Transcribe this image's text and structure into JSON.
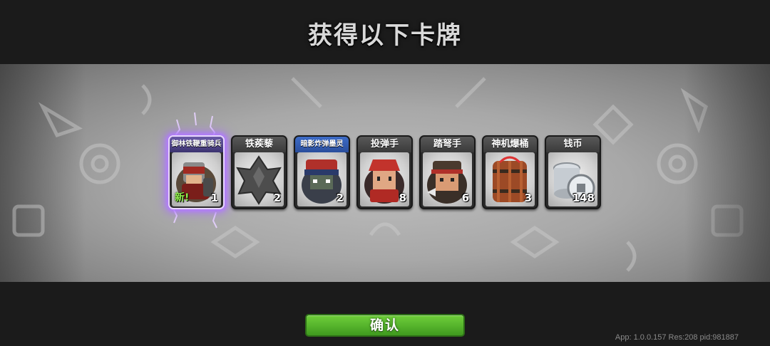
{
  "header": {
    "title": "获得以下卡牌"
  },
  "cards": [
    {
      "name": "御林铁鞭重骑兵",
      "count": "1",
      "badge": "新!",
      "icon": "cavalry-knight-icon"
    },
    {
      "name": "铁蒺藜",
      "count": "2",
      "icon": "caltrops-icon"
    },
    {
      "name": "暗影炸弹墨灵",
      "count": "2",
      "icon": "shadow-bomber-icon"
    },
    {
      "name": "投弹手",
      "count": "8",
      "icon": "grenadier-icon"
    },
    {
      "name": "踏弩手",
      "count": "6",
      "icon": "crossbowman-icon"
    },
    {
      "name": "神机爆桶",
      "count": "3",
      "icon": "explosive-barrel-icon"
    },
    {
      "name": "钱币",
      "count": "148",
      "icon": "coins-icon"
    }
  ],
  "footer": {
    "confirm_label": "确认",
    "version": "App: 1.0.0.157 Res:208 pid:981887"
  },
  "colors": {
    "confirm": "#52b52a",
    "new_glow": "#b27bff",
    "new_text": "#8fef4a"
  }
}
